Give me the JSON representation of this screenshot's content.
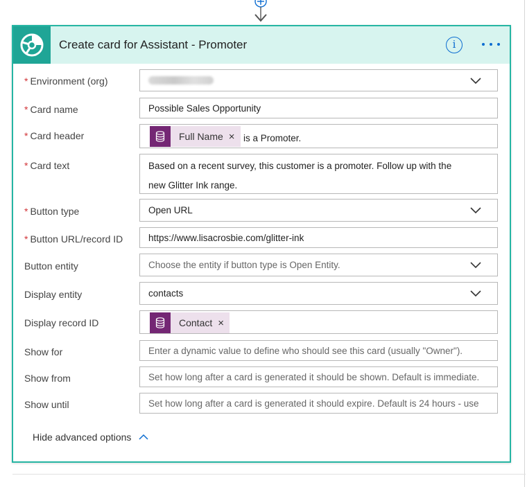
{
  "card": {
    "title": "Create card for Assistant - Promoter",
    "app_icon": "cds-logo-icon",
    "accent_color": "#1fa596",
    "header_bg": "#d7f4ef",
    "info_label": "i"
  },
  "fields": {
    "environment": {
      "label": "Environment (org)",
      "required": true,
      "value": ""
    },
    "card_name": {
      "label": "Card name",
      "required": true,
      "value": "Possible Sales Opportunity"
    },
    "card_header": {
      "label": "Card header",
      "required": true,
      "token": "Full Name",
      "suffix": "is a Promoter."
    },
    "card_text": {
      "label": "Card text",
      "required": true,
      "line1": "Based on a recent survey, this customer is a promoter. Follow up with the",
      "line2": "new Glitter Ink range."
    },
    "button_type": {
      "label": "Button type",
      "required": true,
      "value": "Open URL"
    },
    "button_url": {
      "label": "Button URL/record ID",
      "required": true,
      "value": "https://www.lisacrosbie.com/glitter-ink"
    },
    "button_entity": {
      "label": "Button entity",
      "placeholder": "Choose the entity if button type is Open Entity."
    },
    "display_entity": {
      "label": "Display entity",
      "value": "contacts"
    },
    "display_record_id": {
      "label": "Display record ID",
      "token": "Contact"
    },
    "show_for": {
      "label": "Show for",
      "placeholder": "Enter a dynamic value to define who should see this card (usually \"Owner\")."
    },
    "show_from": {
      "label": "Show from",
      "placeholder": "Set how long after a card is generated it should be shown. Default is immediate."
    },
    "show_until": {
      "label": "Show until",
      "placeholder": "Set how long after a card is generated it should expire. Default is 24 hours - use"
    }
  },
  "required_marker": "*",
  "token_close": "×",
  "advanced_toggle": "Hide advanced options",
  "token_color": "#742774",
  "link_color": "#0b6cd1"
}
